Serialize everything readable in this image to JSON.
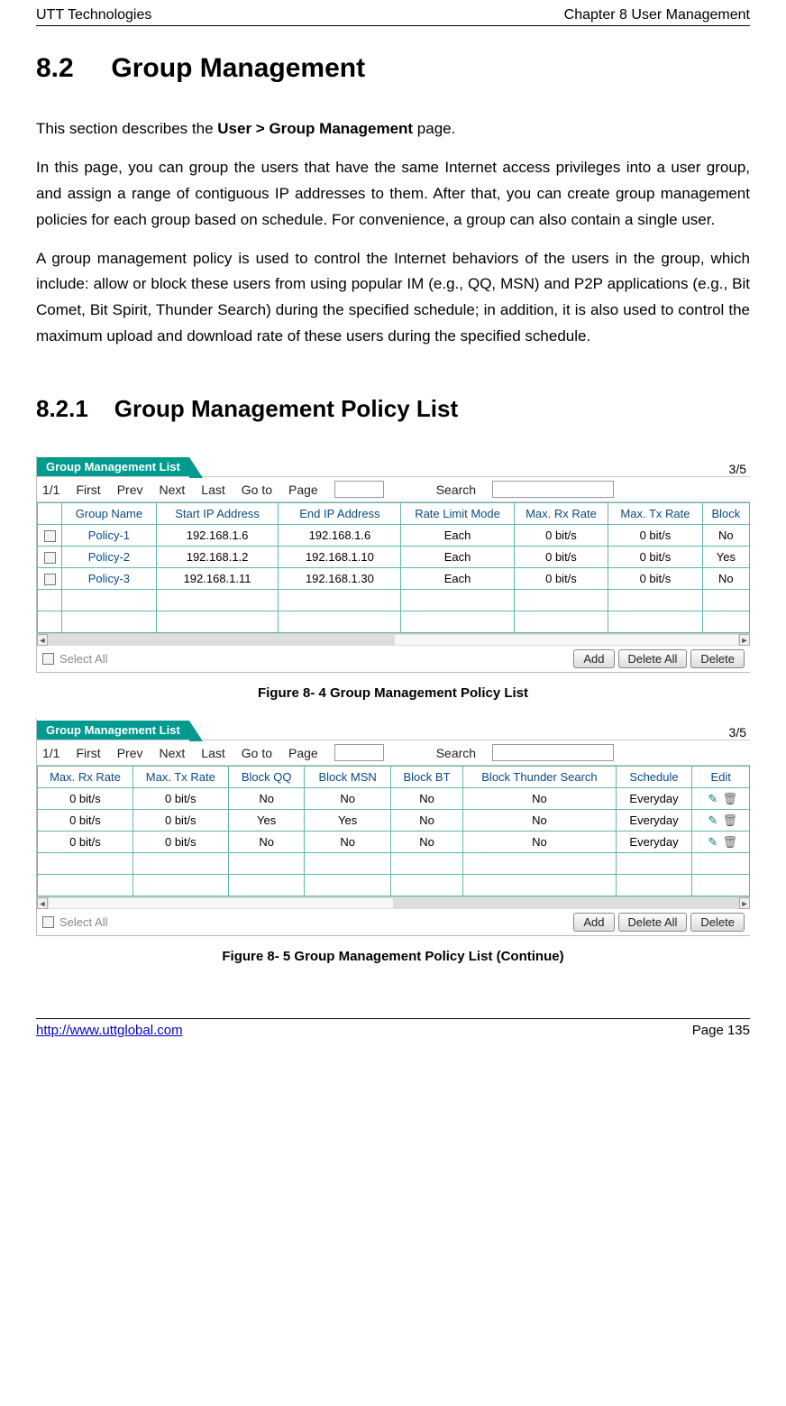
{
  "header": {
    "left": "UTT Technologies",
    "right": "Chapter 8 User Management"
  },
  "section": {
    "num": "8.2",
    "title": "Group Management"
  },
  "intro": {
    "l1_a": "This section describes the ",
    "l1_b": "User > Group Management",
    "l1_c": " page.",
    "p2": "In this page, you can group the users that have the same Internet access privileges into a user group, and assign a range of contiguous IP addresses to them. After that, you can create group management policies for each group based on schedule. For convenience, a group can also contain a single user.",
    "p3": "A group management policy is used to control the Internet behaviors of the users in the group, which include: allow or block these users from using popular IM (e.g., QQ, MSN) and P2P applications (e.g., Bit Comet, Bit Spirit, Thunder Search) during the specified schedule; in addition, it is also used to control the maximum upload and download rate of these users during the specified schedule."
  },
  "subsection": {
    "num": "8.2.1",
    "title": "Group Management Policy List"
  },
  "panel": {
    "tab": "Group Management List",
    "counter": "3/5",
    "pager": {
      "pos": "1/1",
      "first": "First",
      "prev": "Prev",
      "next": "Next",
      "last": "Last",
      "goto": "Go to",
      "page": "Page",
      "search": "Search"
    },
    "select_all": "Select All",
    "buttons": {
      "add": "Add",
      "delete_all": "Delete All",
      "delete": "Delete"
    }
  },
  "table1": {
    "headers": [
      "",
      "Group Name",
      "Start IP Address",
      "End IP Address",
      "Rate Limit Mode",
      "Max. Rx Rate",
      "Max. Tx Rate",
      "Block"
    ],
    "rows": [
      [
        "",
        "Policy-1",
        "192.168.1.6",
        "192.168.1.6",
        "Each",
        "0 bit/s",
        "0 bit/s",
        "No"
      ],
      [
        "",
        "Policy-2",
        "192.168.1.2",
        "192.168.1.10",
        "Each",
        "0 bit/s",
        "0 bit/s",
        "Yes"
      ],
      [
        "",
        "Policy-3",
        "192.168.1.11",
        "192.168.1.30",
        "Each",
        "0 bit/s",
        "0 bit/s",
        "No"
      ]
    ]
  },
  "table2": {
    "headers": [
      "Max. Rx Rate",
      "Max. Tx Rate",
      "Block QQ",
      "Block MSN",
      "Block BT",
      "Block Thunder Search",
      "Schedule",
      "Edit"
    ],
    "rows": [
      [
        "0 bit/s",
        "0 bit/s",
        "No",
        "No",
        "No",
        "No",
        "Everyday"
      ],
      [
        "0 bit/s",
        "0 bit/s",
        "Yes",
        "Yes",
        "No",
        "No",
        "Everyday"
      ],
      [
        "0 bit/s",
        "0 bit/s",
        "No",
        "No",
        "No",
        "No",
        "Everyday"
      ]
    ]
  },
  "captions": {
    "f1": "Figure 8- 4 Group Management Policy List",
    "f2": "Figure 8- 5 Group Management Policy List (Continue)"
  },
  "footer": {
    "url": "http://www.uttglobal.com",
    "page": "Page 135"
  }
}
